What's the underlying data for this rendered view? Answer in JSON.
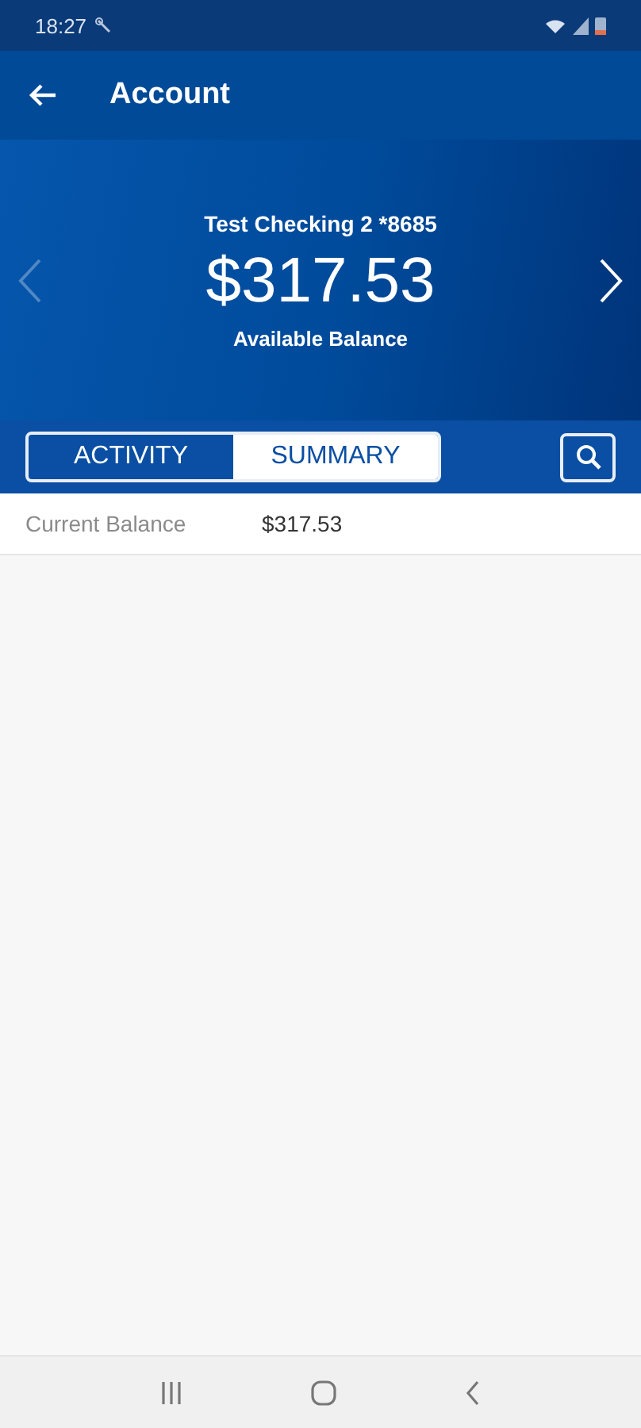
{
  "status_bar": {
    "time": "18:27"
  },
  "app_bar": {
    "title": "Account"
  },
  "account": {
    "name": "Test Checking 2 *8685",
    "balance": "$317.53",
    "balance_label": "Available Balance"
  },
  "carousel_arrows": [
    {
      "kind": "previous",
      "disabled": true
    },
    {
      "kind": "next",
      "disabled": false
    }
  ],
  "tabs": [
    {
      "label": "ACTIVITY",
      "selected": false
    },
    {
      "label": "SUMMARY",
      "selected": true
    }
  ],
  "summary_rows": [
    {
      "label": "Current Balance",
      "value": "$317.53"
    }
  ]
}
